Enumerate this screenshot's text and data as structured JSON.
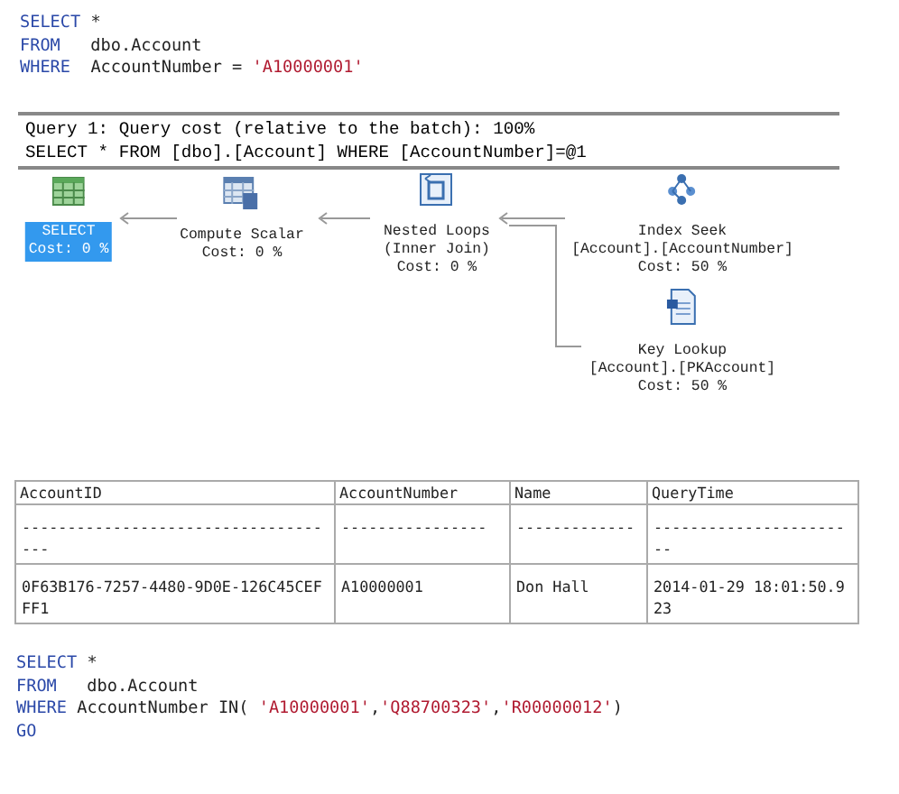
{
  "query_top": {
    "lines": [
      [
        {
          "kind": "keyword",
          "text": "SELECT"
        },
        {
          "kind": "plain",
          "text": " *"
        }
      ],
      [
        {
          "kind": "keyword",
          "text": "FROM"
        },
        {
          "kind": "plain",
          "text": "   dbo.Account"
        }
      ],
      [
        {
          "kind": "keyword",
          "text": "WHERE"
        },
        {
          "kind": "plain",
          "text": "  AccountNumber = "
        },
        {
          "kind": "string",
          "text": "'A10000001'"
        }
      ]
    ]
  },
  "plan": {
    "header": [
      "Query 1: Query cost (relative to the batch): 100%",
      "SELECT * FROM [dbo].[Account] WHERE [AccountNumber]=@1"
    ],
    "nodes": [
      {
        "kind": "select",
        "lines": [
          "SELECT",
          "Cost: 0 %"
        ],
        "selected": true
      },
      {
        "kind": "compute_scalar",
        "lines": [
          "Compute Scalar",
          "Cost: 0 %"
        ],
        "selected": false
      },
      {
        "kind": "nested_loops",
        "lines": [
          "Nested Loops",
          "(Inner Join)",
          "Cost: 0 %"
        ],
        "selected": false
      },
      {
        "kind": "index_seek",
        "lines": [
          "Index Seek",
          "[Account].[AccountNumber]",
          "Cost: 50 %"
        ],
        "selected": false
      },
      {
        "kind": "key_lookup",
        "lines": [
          "Key Lookup",
          "[Account].[PKAccount]",
          "Cost: 50 %"
        ],
        "selected": false
      }
    ]
  },
  "results": {
    "columns": [
      "AccountID",
      "AccountNumber",
      "Name",
      "QueryTime"
    ],
    "rows": [
      [
        "------------------------------------",
        "----------------",
        "-------------",
        "-----------------------"
      ],
      [
        "0F63B176-7257-4480-9D0E-126C45CEFFF1",
        "A10000001",
        "Don Hall",
        "2014-01-29 18:01:50.923"
      ]
    ]
  },
  "query_bottom": {
    "lines": [
      [
        {
          "kind": "keyword",
          "text": "SELECT"
        },
        {
          "kind": "plain",
          "text": " *"
        }
      ],
      [
        {
          "kind": "keyword",
          "text": "FROM"
        },
        {
          "kind": "plain",
          "text": "   dbo.Account"
        }
      ],
      [
        {
          "kind": "keyword",
          "text": "WHERE"
        },
        {
          "kind": "plain",
          "text": " AccountNumber IN( "
        },
        {
          "kind": "string",
          "text": "'A10000001'"
        },
        {
          "kind": "plain",
          "text": ","
        },
        {
          "kind": "string",
          "text": "'Q88700323'"
        },
        {
          "kind": "plain",
          "text": ","
        },
        {
          "kind": "string",
          "text": "'R00000012'"
        },
        {
          "kind": "plain",
          "text": ")"
        }
      ],
      [
        {
          "kind": "keyword",
          "text": "GO"
        }
      ]
    ]
  }
}
